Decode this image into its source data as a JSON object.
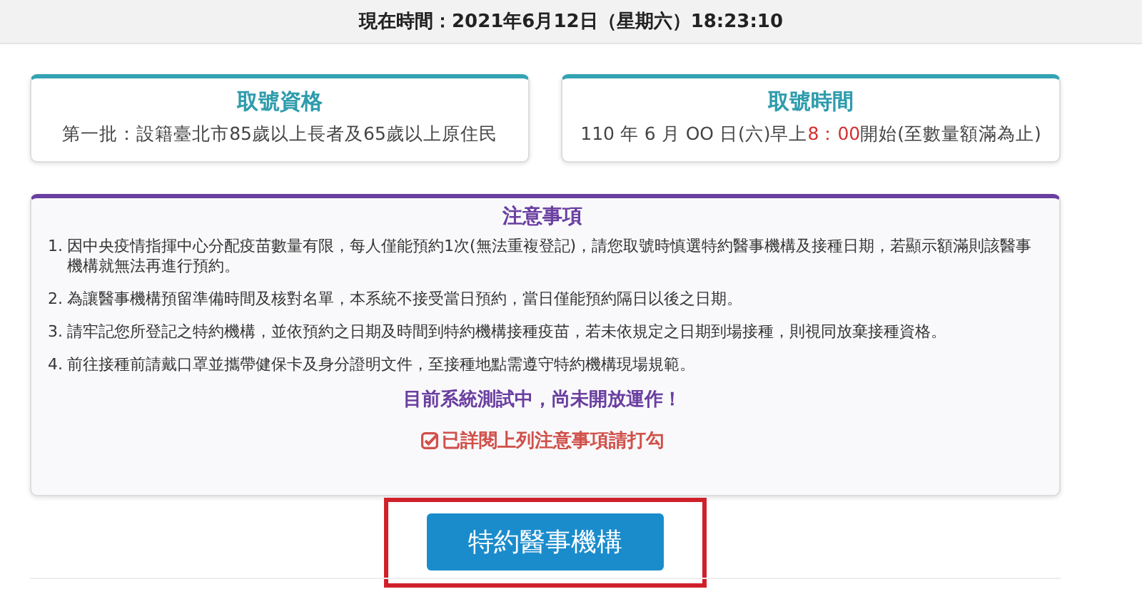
{
  "header": {
    "current_time": "現在時間：2021年6月12日（星期六）18:23:10"
  },
  "info_cards": [
    {
      "title": "取號資格",
      "text": [
        {
          "text": "第一批：設籍臺北市85歲以上長者及65歲以上原住民",
          "emphasis": false
        }
      ]
    },
    {
      "title": "取號時間",
      "text": [
        {
          "text": "110 年 6 月 OO 日(六)早上",
          "emphasis": false
        },
        {
          "text": "8：00",
          "emphasis": true
        },
        {
          "text": "開始(至數量額滿為止)",
          "emphasis": false
        }
      ]
    }
  ],
  "notice": {
    "title": "注意事項",
    "items": [
      {
        "number": "1.",
        "text": "因中央疫情指揮中心分配疫苗數量有限，每人僅能預約1次(無法重複登記)，請您取號時慎選特約醫事機構及接種日期，若顯示額滿則該醫事機構就無法再進行預約。"
      },
      {
        "number": "2.",
        "text": "為讓醫事機構預留準備時間及核對名單，本系統不接受當日預約，當日僅能預約隔日以後之日期。"
      },
      {
        "number": "3.",
        "text": "請牢記您所登記之特約機構，並依預約之日期及時間到特約機構接種疫苗，若未依規定之日期到場接種，則視同放棄接種資格。"
      },
      {
        "number": "4.",
        "text": "前往接種前請戴口罩並攜帶健保卡及身分證明文件，至接種地點需遵守特約機構現場規範。"
      }
    ],
    "status": "目前系統測試中，尚未開放運作！",
    "agreement": {
      "label": "已詳閱上列注意事項請打勾",
      "checked": true
    }
  },
  "button": {
    "label": "特約醫事機構",
    "highlighted": true
  }
}
